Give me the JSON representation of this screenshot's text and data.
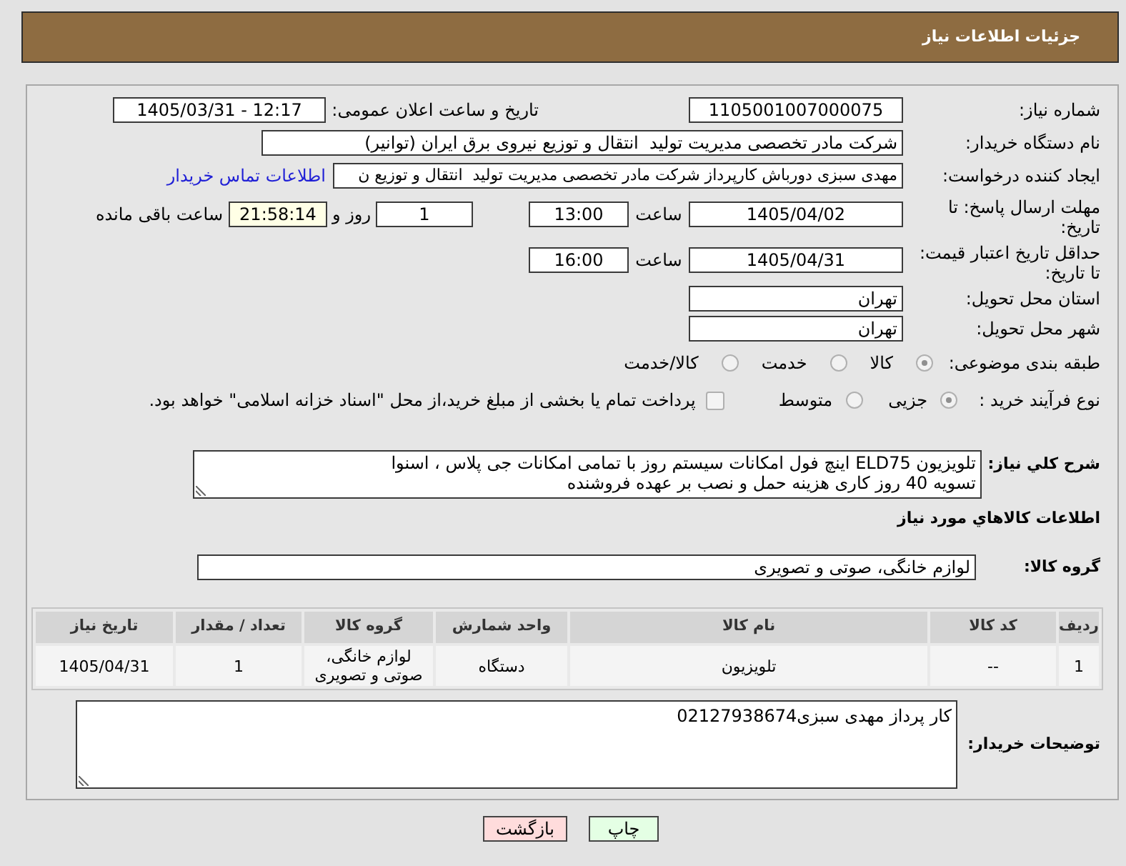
{
  "header": {
    "title": "جزئیات اطلاعات نیاز"
  },
  "fields": {
    "need_number": {
      "label": "شماره نیاز:",
      "value": "1105001007000075"
    },
    "announce_datetime": {
      "label": "تاریخ و ساعت اعلان عمومی:",
      "value": "1405/03/31 - 12:17"
    },
    "buyer_org": {
      "label": "نام دستگاه خریدار:",
      "value": "شرکت مادر تخصصی مدیریت تولید  انتقال و توزیع نیروی برق ایران (توانیر)"
    },
    "requester": {
      "label": "ایجاد کننده درخواست:",
      "value": "مهدی سبزی دورباش کارپرداز شرکت مادر تخصصی مدیریت تولید  انتقال و توزیع ن",
      "link": "اطلاعات تماس خریدار"
    },
    "response_deadline": {
      "label": "مهلت ارسال پاسخ: تا تاریخ:",
      "date": "1405/04/02",
      "time_label": "ساعت",
      "time": "13:00",
      "days": "1",
      "days_label": "روز و",
      "remaining": "21:58:14",
      "remaining_label": "ساعت باقی مانده"
    },
    "price_validity": {
      "label": "حداقل تاریخ اعتبار قیمت: تا تاریخ:",
      "date": "1405/04/31",
      "time_label": "ساعت",
      "time": "16:00"
    },
    "province": {
      "label": "استان محل تحویل:",
      "value": "تهران"
    },
    "city": {
      "label": "شهر محل تحویل:",
      "value": "تهران"
    },
    "category": {
      "label": "طبقه بندی موضوعی:",
      "options": [
        {
          "label": "کالا",
          "selected": true
        },
        {
          "label": "خدمت",
          "selected": false
        },
        {
          "label": "کالا/خدمت",
          "selected": false
        }
      ]
    },
    "purchase_process": {
      "label": "نوع فرآیند خرید :",
      "options": [
        {
          "label": "جزیی",
          "selected": true
        },
        {
          "label": "متوسط",
          "selected": false
        }
      ],
      "treasury": {
        "label": "پرداخت تمام یا بخشی از مبلغ خرید،از محل \"اسناد خزانه اسلامی\" خواهد بود.",
        "checked": false
      }
    }
  },
  "description": {
    "label": "شرح کلي نیاز:",
    "value": "تلویزیون ELD75 اینچ فول امکانات سیستم روز با تمامی امکانات جی پلاس ، اسنوا\nتسویه 40 روز کاری هزینه حمل و نصب بر عهده فروشنده"
  },
  "items_section": {
    "title": "اطلاعات کالاهاي مورد نیاز",
    "group": {
      "label": "گروه کالا:",
      "value": "لوازم خانگی، صوتی و تصویری"
    },
    "table": {
      "columns": [
        "ردیف",
        "کد کالا",
        "نام کالا",
        "واحد شمارش",
        "گروه کالا",
        "تعداد / مقدار",
        "تاریخ نیاز"
      ],
      "rows": [
        [
          "1",
          "--",
          "تلویزیون",
          "دستگاه",
          "لوازم خانگی، صوتی و تصویری",
          "1",
          "1405/04/31"
        ]
      ]
    }
  },
  "buyer_notes": {
    "label": "توضیحات خریدار:",
    "value": "کار پرداز مهدی سبزی02127938674"
  },
  "buttons": [
    {
      "label": "چاپ",
      "kind": "print"
    },
    {
      "label": "بازگشت",
      "kind": "back"
    }
  ]
}
